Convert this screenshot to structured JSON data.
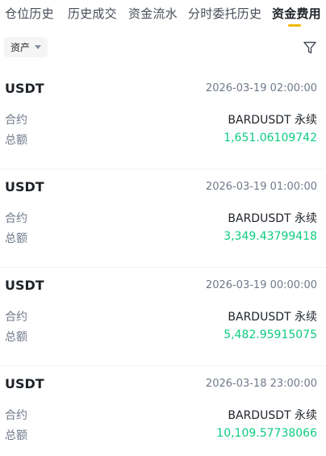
{
  "tabs": [
    {
      "label": "仓位历史",
      "active": false
    },
    {
      "label": "历史成交",
      "active": false
    },
    {
      "label": "资金流水",
      "active": false
    },
    {
      "label": "分时委托历史",
      "active": false
    },
    {
      "label": "资金费用",
      "active": true
    }
  ],
  "filter": {
    "asset_label": "资产",
    "caret_icon": "caret-down-icon",
    "filter_icon": "filter-icon"
  },
  "labels": {
    "contract": "合约",
    "total": "总额"
  },
  "records": [
    {
      "asset": "USDT",
      "time": "2026-03-19 02:00:00",
      "contract": "BARDUSDT 永续",
      "total": "1,651.06109742"
    },
    {
      "asset": "USDT",
      "time": "2026-03-19 01:00:00",
      "contract": "BARDUSDT 永续",
      "total": "3,349.43799418"
    },
    {
      "asset": "USDT",
      "time": "2026-03-19 00:00:00",
      "contract": "BARDUSDT 永续",
      "total": "5,482.95915075"
    },
    {
      "asset": "USDT",
      "time": "2026-03-18 23:00:00",
      "contract": "BARDUSDT 永续",
      "total": "10,109.57738066"
    }
  ],
  "colors": {
    "accent": "#f0b90b",
    "positive": "#0ecb81",
    "secondary_text": "#707a8a"
  }
}
